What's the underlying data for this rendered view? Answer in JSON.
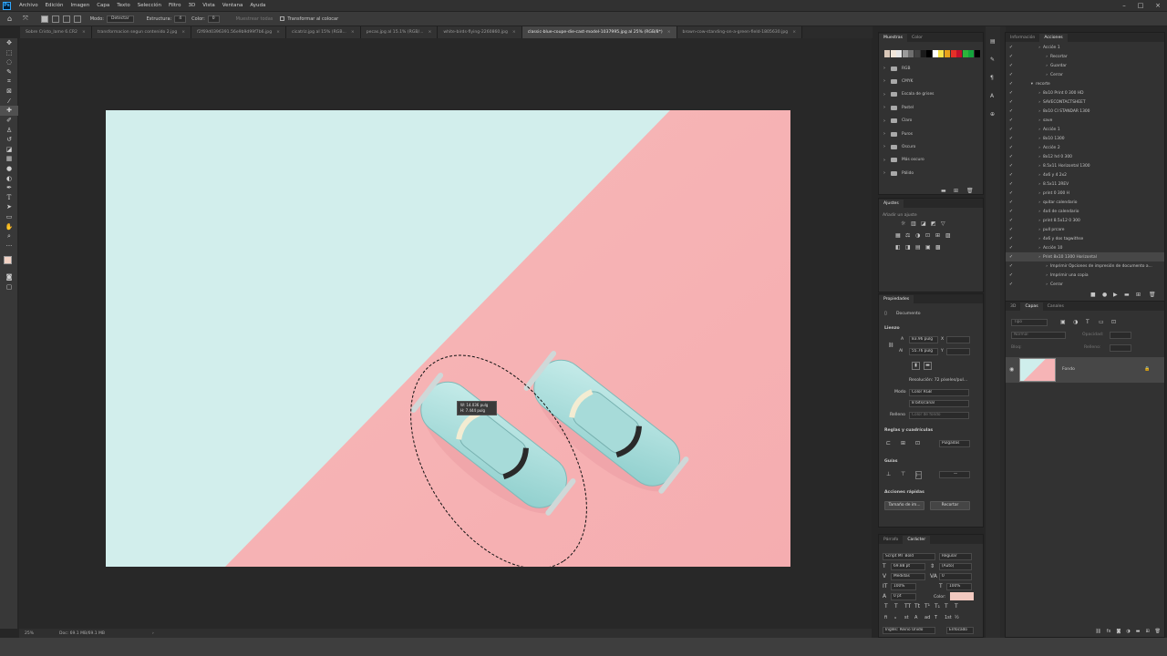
{
  "menubar": {
    "items": [
      "Archivo",
      "Edición",
      "Imagen",
      "Capa",
      "Texto",
      "Selección",
      "Filtro",
      "3D",
      "Vista",
      "Ventana",
      "Ayuda"
    ]
  },
  "options": {
    "mode_label": "Modo:",
    "mode_value": "Detectar",
    "structure_label": "Estructura:",
    "structure_value": "4",
    "color_label": "Color:",
    "color_value": "0",
    "sample_all": "Muestrear todas",
    "transform_on_drop": "Transformar al colocar"
  },
  "tabs": [
    "Sobre Cristo_lame 6.CR2",
    "transformacion segun contenido 2.jpg",
    "f2f69d0396391.56e9b9d99f7b6.jpg",
    "cicatriz.jpg al 15% (RGB...",
    "pecas.jpg al 15.1% (RGB/...",
    "white-birds-flying-2260860.jpg",
    "classic-blue-coupe-die-cast-model-1037995.jpg al 25% (RGB/8*)",
    "brown-cow-standing-on-a-green-field-1805630.jpg"
  ],
  "transform_readout": {
    "w": "W: 14.036 pulg",
    "h": "H: 7.444 pulg"
  },
  "status": {
    "zoom": "25%",
    "doc": "Doc: 69.1 MB/69.1 MB"
  },
  "swatches_panel": {
    "tabs": [
      "Muestras",
      "Color"
    ],
    "colors": [
      "#d9c7b8",
      "#f1e6da",
      "#e6e6e6",
      "#9b9b9b",
      "#6f6f6f",
      "#414141",
      "#1a1a1a",
      "#000000",
      "#ffffff",
      "#f7e24a",
      "#e8a21b",
      "#e63027",
      "#c3112c",
      "#2db43b",
      "#14a33c",
      "#000000"
    ],
    "groups": [
      "RGB",
      "CMYK",
      "Escala de grises",
      "Pastel",
      "Claro",
      "Puros",
      "Oscuro",
      "Más oscuro",
      "Pálido"
    ]
  },
  "adjustments_panel": {
    "title": "Ajustes",
    "hint": "Añadir un ajuste"
  },
  "properties_panel": {
    "title": "Propiedades",
    "doc_label": "Documento",
    "canvas_section": "Lienzo",
    "w_label": "A",
    "w_value": "83.96 pulg",
    "h_label": "Al",
    "h_value": "55.76 pulg",
    "x_label": "X",
    "y_label": "Y",
    "resolution": "Resolución: 72 píxeles/pul...",
    "mode_label": "Modo",
    "mode_value": "Color RGB",
    "bits_value": "8 bits/canal",
    "fill_label": "Relleno",
    "fill_value": "Color de fondo",
    "rulers_section": "Reglas y cuadrículas",
    "units": "Pulgadas",
    "guides_section": "Guías",
    "quick_actions": "Acciones rápidas",
    "image_size_btn": "Tamaño de im...",
    "crop_btn": "Recortar"
  },
  "character_panel": {
    "tabs": [
      "Párrafo",
      "Carácter"
    ],
    "font": "Script MT Bold",
    "style": "Regular",
    "size": "69.88 pt",
    "leading": "(Auto)",
    "kerning": "Medidas",
    "tracking": "0",
    "v_scale": "100%",
    "h_scale": "100%",
    "baseline": "0 pt",
    "color_label": "Color:",
    "language": "Inglés: Reino Unido",
    "antialias": "Enfocado",
    "text_color": "#f2c9c0"
  },
  "actions_panel": {
    "tabs": [
      "Información",
      "Acciones"
    ],
    "items": [
      {
        "label": "Acción 1",
        "indent": 3
      },
      {
        "label": "Recortar",
        "indent": 4
      },
      {
        "label": "Guardar",
        "indent": 4
      },
      {
        "label": "Cerrar",
        "indent": 4
      },
      {
        "label": "recorte",
        "indent": 2
      },
      {
        "label": "8x10 Print 0 300 HD",
        "indent": 3
      },
      {
        "label": "SAVECONTACTSHEET",
        "indent": 3
      },
      {
        "label": "8x10 CI STANDAR 1300",
        "indent": 3
      },
      {
        "label": "save",
        "indent": 3
      },
      {
        "label": "Acción 1",
        "indent": 3
      },
      {
        "label": "8x10 1300",
        "indent": 3
      },
      {
        "label": "Acción 2",
        "indent": 3
      },
      {
        "label": "8x12 hd 0 300",
        "indent": 3
      },
      {
        "label": "8.5x11 Horizontal 1300",
        "indent": 3
      },
      {
        "label": "4x6 y 4 2x2",
        "indent": 3
      },
      {
        "label": "8.5x11 2REV",
        "indent": 3
      },
      {
        "label": "print 0 300 H",
        "indent": 3
      },
      {
        "label": "quitar calendario",
        "indent": 3
      },
      {
        "label": "4x4 de calendario",
        "indent": 3
      },
      {
        "label": "print 8.5x12 0 300",
        "indent": 3
      },
      {
        "label": "pull prcare",
        "indent": 3
      },
      {
        "label": "4x6 y dos tagwithse",
        "indent": 3
      },
      {
        "label": "Acción 10",
        "indent": 3
      },
      {
        "label": "Print 8x10 1300 Horizontal",
        "indent": 3
      },
      {
        "label": "Imprimir Opciones de impresión de documento a...",
        "indent": 4
      },
      {
        "label": "Imprimir una copia",
        "indent": 4
      },
      {
        "label": "Cerrar",
        "indent": 4
      }
    ]
  },
  "layers_panel": {
    "tabs": [
      "3D",
      "Capas",
      "Canales"
    ],
    "kind_placeholder": "Tipo",
    "blend": "Normal",
    "opacity_label": "Opacidad:",
    "lock_label": "Bloq:",
    "fill_label": "Relleno:",
    "layer_name": "Fondo"
  }
}
